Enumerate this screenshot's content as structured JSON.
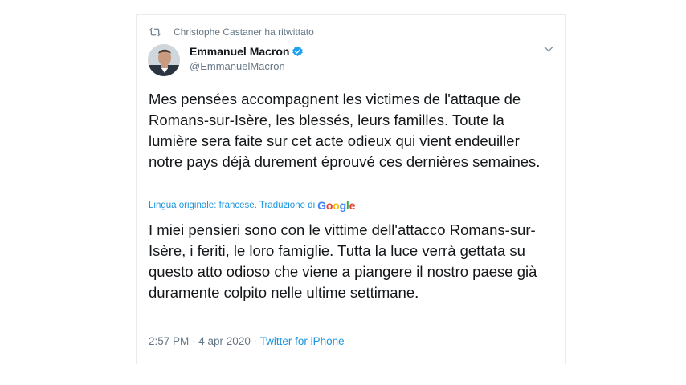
{
  "retweet": {
    "icon": "retweet-icon",
    "label": "Christophe Castaner ha ritwittato"
  },
  "author": {
    "name": "Emmanuel Macron",
    "handle": "@EmmanuelMacron",
    "verified": true,
    "avatar": "avatar"
  },
  "tweet": {
    "text": "Mes pensées accompagnent les victimes de l'attaque de Romans-sur-Isère, les blessés, leurs familles. Toute la lumière sera faite sur cet acte odieux qui vient endeuiller notre pays déjà durement éprouvé ces dernières semaines.",
    "translation_label": "Lingua originale: francese. Traduzione di",
    "translator_brand": "Google",
    "translated_text": "I miei pensieri sono con le vittime dell'attacco Romans-sur-Isère, i feriti, le loro famiglie. Tutta la luce verrà gettata su questo atto odioso che viene a piangere il nostro paese già duramente colpito nelle ultime settimane."
  },
  "meta": {
    "time": "2:57 PM",
    "separator": " · ",
    "date": "4 apr 2020",
    "source": "Twitter for iPhone"
  },
  "colors": {
    "link": "#1b95e0",
    "secondary_text": "#657786",
    "primary_text": "#14171a",
    "verified": "#1da1f2"
  }
}
